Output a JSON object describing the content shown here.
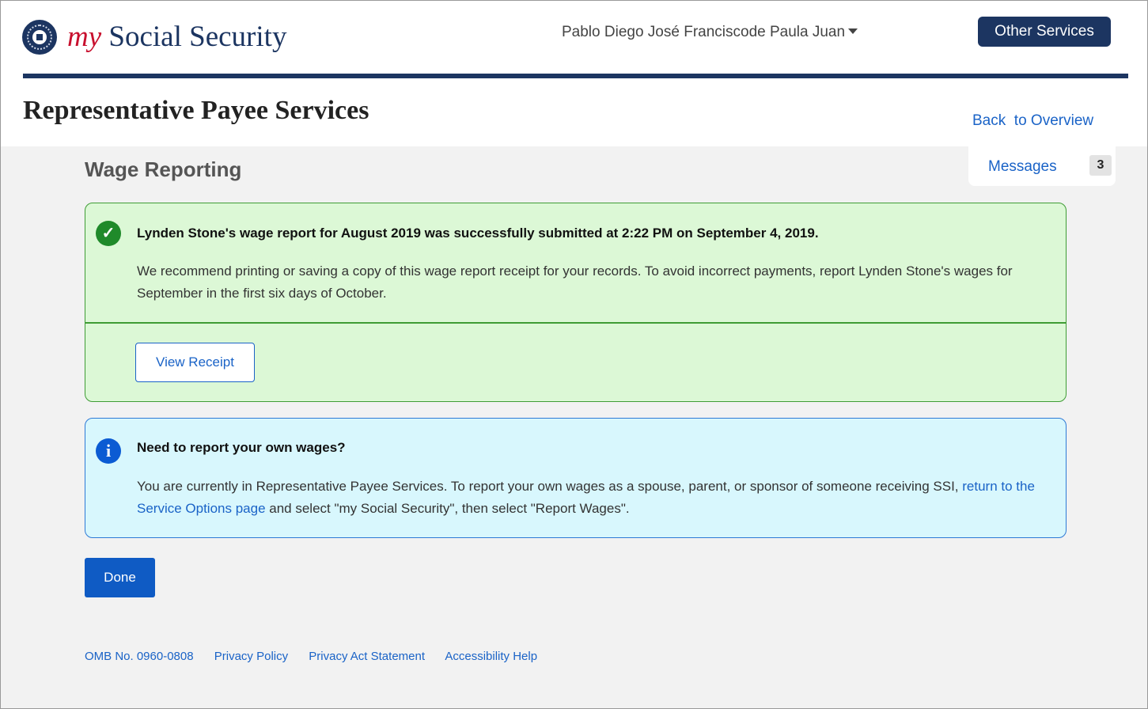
{
  "header": {
    "brand_prefix": "my",
    "brand_name": " Social Security",
    "user_name": "Pablo Diego José Franciscode Paula Juan",
    "other_services_label": "Other Services"
  },
  "page": {
    "title": "Representative Payee Services",
    "back_link": "Back  to Overview",
    "messages_label": "Messages",
    "messages_count": "3",
    "section_title": "Wage Reporting"
  },
  "success_alert": {
    "icon": "check-circle-icon",
    "heading": "Lynden Stone's wage report for August 2019 was successfully submitted at 2:22 PM on September 4, 2019.",
    "body": "We recommend printing or saving a copy of this wage report receipt for your records. To avoid incorrect payments, report Lynden Stone's wages for September in the first six days of October.",
    "button_label": "View Receipt"
  },
  "info_alert": {
    "icon": "info-circle-icon",
    "heading": "Need to report your own wages?",
    "body_before": "You are currently in Representative Payee Services. To report your own wages as a spouse, parent, or sponsor of someone receiving SSI, ",
    "link_text": "return to the Service Options page",
    "body_after": " and select \"my Social Security\", then select \"Report Wages\"."
  },
  "done_label": "Done",
  "footer": {
    "omb": "OMB No. 0960-0808",
    "privacy_policy": "Privacy Policy",
    "privacy_act": "Privacy Act Statement",
    "accessibility": "Accessibility Help"
  },
  "colors": {
    "brand_navy": "#1c3561",
    "brand_red": "#c8102e",
    "link_blue": "#1a63c7",
    "success_bg": "#dcf8d6",
    "success_border": "#3f9c35",
    "info_bg": "#d8f7fd",
    "info_border": "#2d7ad6",
    "primary_button": "#0f5bc4"
  }
}
